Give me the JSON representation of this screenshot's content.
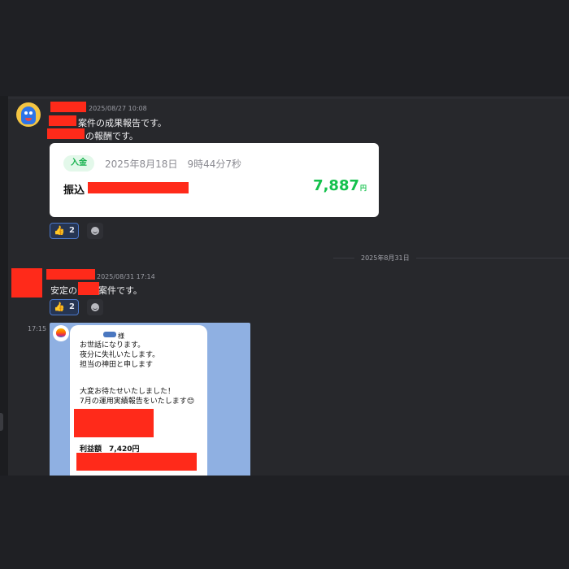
{
  "messages": [
    {
      "timestamp": "2025/08/27 10:08",
      "lines": [
        "案件の成果報告です。",
        "の報酬です。"
      ],
      "receipt": {
        "badge": "入金",
        "datetime": "2025年8月18日　9時44分7秒",
        "transfer_label": "振込",
        "amount": "7,887",
        "unit": "円"
      },
      "reaction": {
        "emoji": "👍",
        "count": "2"
      }
    },
    {
      "date_divider": "2025年8月31日",
      "timestamp": "2025/08/31 17:14",
      "text_prefix": "安定の",
      "text_suffix": "案件です。",
      "reaction": {
        "emoji": "👍",
        "count": "2"
      }
    },
    {
      "time": "17:15",
      "screenshot": {
        "name_suffix": "様",
        "greeting_lines": [
          "お世話になります。",
          "夜分に失礼いたします。",
          "担当の神田と申します"
        ],
        "apology_lines": [
          "大変お待たせいたしました！",
          "7月の運用実績報告をいたします"
        ],
        "emoji": "😊",
        "profit_label": "利益額",
        "profit_value": "7,420円"
      }
    }
  ],
  "colors": {
    "background": "#1f2024",
    "chat_background": "#27282c",
    "redaction": "#ff2a1a",
    "amount_green": "#14c14c",
    "reaction_border": "#4a77c9"
  },
  "icons": [
    "user-avatar-icon",
    "thumbs-up-icon",
    "add-reaction-icon",
    "apple-icon"
  ]
}
